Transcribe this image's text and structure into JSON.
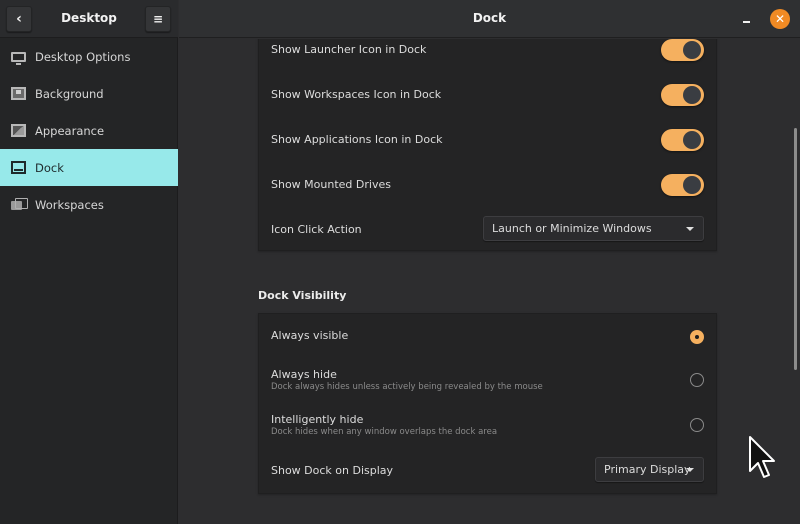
{
  "sidebar": {
    "title": "Desktop",
    "back_icon": "chevron-left-icon",
    "menu_icon": "hamburger-menu-icon",
    "items": [
      {
        "label": "Desktop Options",
        "icon": "monitor-icon",
        "active": false
      },
      {
        "label": "Background",
        "icon": "wallpaper-icon",
        "active": false
      },
      {
        "label": "Appearance",
        "icon": "appearance-icon",
        "active": false
      },
      {
        "label": "Dock",
        "icon": "dock-icon",
        "active": true
      },
      {
        "label": "Workspaces",
        "icon": "workspaces-icon",
        "active": false
      }
    ]
  },
  "header": {
    "title": "Dock",
    "minimize_glyph": "",
    "close_glyph": "✕"
  },
  "dock_items": {
    "rows": [
      {
        "label": "Show Launcher Icon in Dock",
        "enabled": true
      },
      {
        "label": "Show Workspaces Icon in Dock",
        "enabled": true
      },
      {
        "label": "Show Applications Icon in Dock",
        "enabled": true
      },
      {
        "label": "Show Mounted Drives",
        "enabled": true
      }
    ],
    "icon_click_action": {
      "label": "Icon Click Action",
      "value": "Launch or Minimize Windows"
    }
  },
  "dock_visibility": {
    "title": "Dock Visibility",
    "options": [
      {
        "label": "Always visible",
        "description": "",
        "selected": true
      },
      {
        "label": "Always hide",
        "description": "Dock always hides unless actively being revealed by the mouse",
        "selected": false
      },
      {
        "label": "Intelligently hide",
        "description": "Dock hides when any window overlaps the dock area",
        "selected": false
      }
    ],
    "display": {
      "label": "Show Dock on Display",
      "value": "Primary Display"
    }
  },
  "colors": {
    "accent": "#f5b05f",
    "sidebar_active": "#97e9ea",
    "close_button": "#f08a24"
  }
}
